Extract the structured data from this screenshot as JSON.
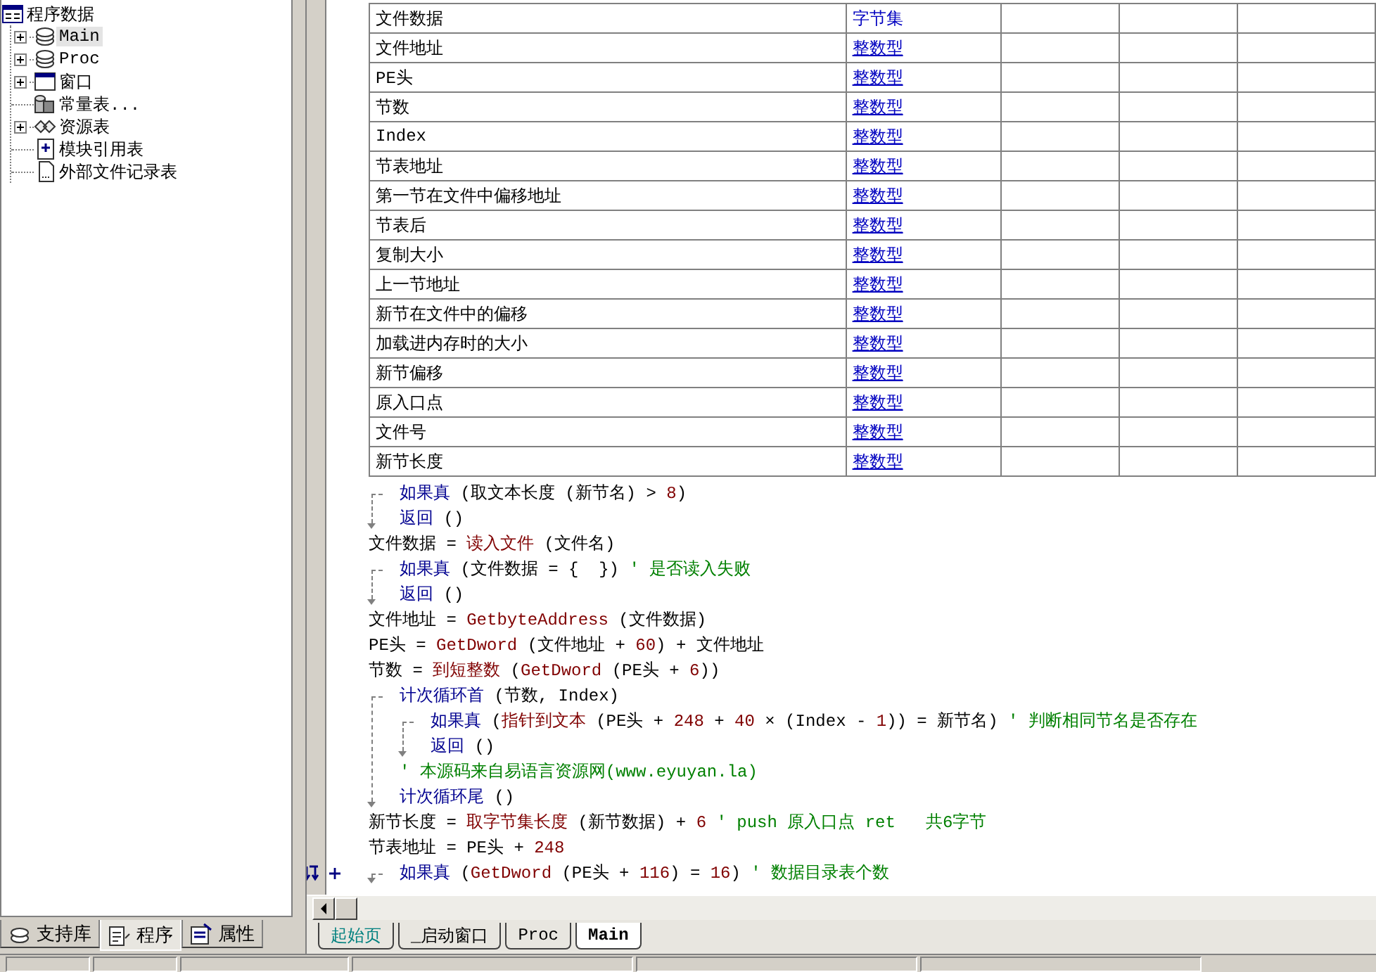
{
  "tree": {
    "root": "程序数据",
    "items": [
      {
        "label": "Main",
        "kind": "module",
        "expandable": true,
        "selected": true
      },
      {
        "label": "Proc",
        "kind": "module",
        "expandable": true,
        "selected": false
      },
      {
        "label": "窗口",
        "kind": "window",
        "expandable": true,
        "selected": false
      },
      {
        "label": "常量表...",
        "kind": "constants",
        "expandable": false,
        "selected": false
      },
      {
        "label": "资源表",
        "kind": "resources",
        "expandable": true,
        "selected": false
      },
      {
        "label": "模块引用表",
        "kind": "module-ref",
        "expandable": false,
        "selected": false
      },
      {
        "label": "外部文件记录表",
        "kind": "external",
        "expandable": false,
        "selected": false
      }
    ]
  },
  "panel_tabs": [
    {
      "label": "支持库",
      "kind": "library",
      "selected": false
    },
    {
      "label": "程序",
      "kind": "program",
      "selected": true
    },
    {
      "label": "属性",
      "kind": "properties",
      "selected": false
    }
  ],
  "variables": [
    {
      "name": "文件数据",
      "type": "字节集",
      "underlined": false
    },
    {
      "name": "文件地址",
      "type": "整数型",
      "underlined": true
    },
    {
      "name": "PE头",
      "type": "整数型",
      "underlined": true
    },
    {
      "name": "节数",
      "type": "整数型",
      "underlined": true
    },
    {
      "name": "Index",
      "type": "整数型",
      "underlined": true
    },
    {
      "name": "节表地址",
      "type": "整数型",
      "underlined": true
    },
    {
      "name": "第一节在文件中偏移地址",
      "type": "整数型",
      "underlined": true
    },
    {
      "name": "节表后",
      "type": "整数型",
      "underlined": true
    },
    {
      "name": "复制大小",
      "type": "整数型",
      "underlined": true
    },
    {
      "name": "上一节地址",
      "type": "整数型",
      "underlined": true
    },
    {
      "name": "新节在文件中的偏移",
      "type": "整数型",
      "underlined": true
    },
    {
      "name": "加载进内存时的大小",
      "type": "整数型",
      "underlined": true
    },
    {
      "name": "新节偏移",
      "type": "整数型",
      "underlined": true
    },
    {
      "name": "原入口点",
      "type": "整数型",
      "underlined": true
    },
    {
      "name": "文件号",
      "type": "整数型",
      "underlined": true
    },
    {
      "name": "新节长度",
      "type": "整数型",
      "underlined": true
    }
  ],
  "code": [
    {
      "kind": "block",
      "marked": false,
      "head": [
        {
          "kind": "keyword",
          "text": "如果真"
        },
        {
          "kind": "plain",
          "text": " (取文本长度 (新节名) > "
        },
        {
          "kind": "number",
          "text": "8"
        },
        {
          "kind": "plain",
          "text": ")"
        }
      ],
      "children": [
        {
          "kind": "line",
          "segments": [
            {
              "kind": "keyword",
              "text": "返回"
            },
            {
              "kind": "plain",
              "text": " ()"
            }
          ]
        }
      ]
    },
    {
      "kind": "line",
      "segments": [
        {
          "kind": "plain",
          "text": "文件数据 = "
        },
        {
          "kind": "function",
          "text": "读入文件"
        },
        {
          "kind": "plain",
          "text": " (文件名)"
        }
      ]
    },
    {
      "kind": "block",
      "marked": false,
      "head": [
        {
          "kind": "keyword",
          "text": "如果真"
        },
        {
          "kind": "plain",
          "text": " (文件数据 = {  })"
        },
        {
          "kind": "comment",
          "text": "' 是否读入失败"
        }
      ],
      "children": [
        {
          "kind": "line",
          "segments": [
            {
              "kind": "keyword",
              "text": "返回"
            },
            {
              "kind": "plain",
              "text": " ()"
            }
          ]
        }
      ]
    },
    {
      "kind": "line",
      "segments": [
        {
          "kind": "plain",
          "text": "文件地址 = "
        },
        {
          "kind": "function",
          "text": "GetbyteAddress"
        },
        {
          "kind": "plain",
          "text": " (文件数据)"
        }
      ]
    },
    {
      "kind": "line",
      "segments": [
        {
          "kind": "plain",
          "text": "PE头 = "
        },
        {
          "kind": "function",
          "text": "GetDword"
        },
        {
          "kind": "plain",
          "text": " (文件地址 + "
        },
        {
          "kind": "number",
          "text": "60"
        },
        {
          "kind": "plain",
          "text": ") + 文件地址"
        }
      ]
    },
    {
      "kind": "line",
      "segments": [
        {
          "kind": "plain",
          "text": "节数 = "
        },
        {
          "kind": "function",
          "text": "到短整数"
        },
        {
          "kind": "plain",
          "text": " ("
        },
        {
          "kind": "function",
          "text": "GetDword"
        },
        {
          "kind": "plain",
          "text": " (PE头 + "
        },
        {
          "kind": "number",
          "text": "6"
        },
        {
          "kind": "plain",
          "text": "))"
        }
      ]
    },
    {
      "kind": "block",
      "marked": false,
      "head": [
        {
          "kind": "keyword",
          "text": "计次循环首"
        },
        {
          "kind": "plain",
          "text": " (节数, Index)"
        }
      ],
      "children": [
        {
          "kind": "block",
          "marked": false,
          "head": [
            {
              "kind": "keyword",
              "text": "如果真"
            },
            {
              "kind": "plain",
              "text": " ("
            },
            {
              "kind": "function",
              "text": "指针到文本"
            },
            {
              "kind": "plain",
              "text": " (PE头 + "
            },
            {
              "kind": "number",
              "text": "248"
            },
            {
              "kind": "plain",
              "text": " + "
            },
            {
              "kind": "number",
              "text": "40"
            },
            {
              "kind": "plain",
              "text": " × (Index - "
            },
            {
              "kind": "number",
              "text": "1"
            },
            {
              "kind": "plain",
              "text": ")) = 新节名)"
            },
            {
              "kind": "comment",
              "text": "' 判断相同节名是否存在"
            }
          ],
          "children": [
            {
              "kind": "line",
              "segments": [
                {
                  "kind": "keyword",
                  "text": "返回"
                },
                {
                  "kind": "plain",
                  "text": " ()"
                }
              ]
            }
          ]
        },
        {
          "kind": "line",
          "segments": [
            {
              "kind": "comment",
              "text": "' 本源码来自易语言资源网(www.eyuyan.la)"
            }
          ]
        }
      ],
      "tail": [
        {
          "kind": "keyword",
          "text": "计次循环尾"
        },
        {
          "kind": "plain",
          "text": " ()"
        }
      ]
    },
    {
      "kind": "line",
      "segments": [
        {
          "kind": "plain",
          "text": "新节长度 = "
        },
        {
          "kind": "function",
          "text": "取字节集长度"
        },
        {
          "kind": "plain",
          "text": " (新节数据) + "
        },
        {
          "kind": "number",
          "text": "6"
        },
        {
          "kind": "comment",
          "text": "' push 原入口点 ret   共6字节"
        }
      ]
    },
    {
      "kind": "line",
      "segments": [
        {
          "kind": "plain",
          "text": "节表地址 = PE头 + "
        },
        {
          "kind": "number",
          "text": "248"
        }
      ]
    },
    {
      "kind": "block",
      "marked": true,
      "head": [
        {
          "kind": "keyword",
          "text": "如果真"
        },
        {
          "kind": "plain",
          "text": " ("
        },
        {
          "kind": "function",
          "text": "GetDword"
        },
        {
          "kind": "plain",
          "text": " (PE头 + "
        },
        {
          "kind": "number",
          "text": "116"
        },
        {
          "kind": "plain",
          "text": ") = "
        },
        {
          "kind": "number",
          "text": "16"
        },
        {
          "kind": "plain",
          "text": ")"
        },
        {
          "kind": "comment",
          "text": "' 数据目录表个数"
        }
      ]
    }
  ],
  "editor_tabs": [
    {
      "label": "起始页",
      "kind": "start",
      "selected": false
    },
    {
      "label": "_启动窗口",
      "kind": "file",
      "selected": false
    },
    {
      "label": "Proc",
      "kind": "file",
      "selected": false
    },
    {
      "label": "Main",
      "kind": "file",
      "selected": true
    }
  ]
}
